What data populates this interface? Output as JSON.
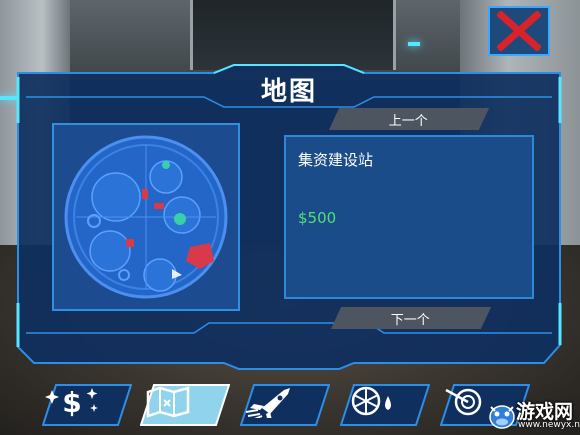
{
  "panel": {
    "title": "地图",
    "prev_label": "上一个",
    "next_label": "下一个"
  },
  "item": {
    "name": "集资建设站",
    "price": "$500"
  },
  "toolbar": {
    "tabs": [
      {
        "icon": "money-icon",
        "label": "$",
        "selected": false
      },
      {
        "icon": "map-icon",
        "selected": true
      },
      {
        "icon": "rocket-icon",
        "selected": false
      },
      {
        "icon": "resources-icon",
        "selected": false
      },
      {
        "icon": "target-icon",
        "selected": false
      }
    ]
  },
  "watermark": {
    "title": "游戏网",
    "url": "www.newyx.net"
  },
  "colors": {
    "panel_bg": "#0f2f5f",
    "panel_border": "#2c8fe6",
    "accent_cyan": "#56e6ff",
    "price_green": "#4fe07a",
    "close_red": "#d8232a",
    "nav_button": "#4c5560"
  }
}
